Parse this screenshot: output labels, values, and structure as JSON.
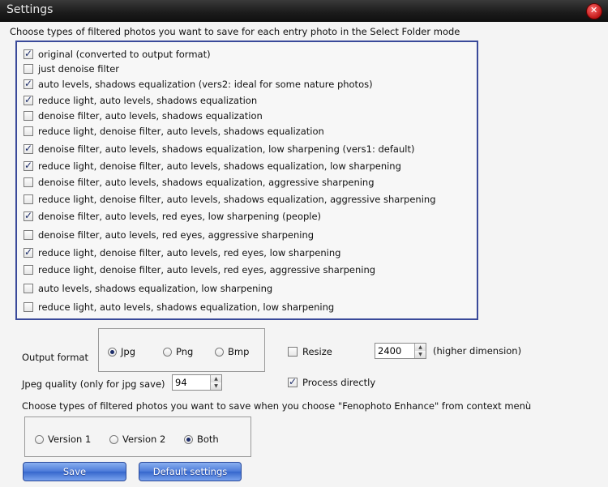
{
  "window": {
    "title": "Settings"
  },
  "heading_entry": "Choose types of filtered photos you want to save for each entry photo in the Select Folder mode",
  "filters": [
    {
      "label": "original (converted to output format)",
      "checked": true
    },
    {
      "label": "just denoise filter",
      "checked": false
    },
    {
      "label": "auto levels, shadows equalization (vers2: ideal for some nature photos)",
      "checked": true
    },
    {
      "label": "reduce light, auto levels, shadows equalization",
      "checked": true
    },
    {
      "label": "denoise filter, auto levels, shadows equalization",
      "checked": false
    },
    {
      "label": "reduce light, denoise filter, auto levels, shadows equalization",
      "checked": false
    },
    {
      "label": "denoise filter, auto levels, shadows equalization, low sharpening (vers1: default)",
      "checked": true
    },
    {
      "label": "reduce light, denoise filter, auto levels, shadows equalization, low sharpening",
      "checked": true
    },
    {
      "label": "denoise filter, auto levels, shadows equalization, aggressive sharpening",
      "checked": false
    },
    {
      "label": "reduce light, denoise filter, auto levels, shadows equalization, aggressive sharpening",
      "checked": false
    },
    {
      "label": "denoise filter, auto levels, red eyes, low sharpening (people)",
      "checked": true
    },
    {
      "label": "denoise filter, auto levels, red eyes, aggressive sharpening",
      "checked": false
    },
    {
      "label": "reduce light, denoise filter, auto levels, red eyes, low sharpening",
      "checked": true
    },
    {
      "label": "reduce light, denoise filter, auto levels, red eyes, aggressive sharpening",
      "checked": false
    },
    {
      "label": "auto levels, shadows equalization, low sharpening",
      "checked": false
    },
    {
      "label": "reduce light, auto levels, shadows equalization, low sharpening",
      "checked": false
    }
  ],
  "output_format": {
    "label": "Output format",
    "options": [
      "Jpg",
      "Png",
      "Bmp"
    ],
    "selected": "Jpg"
  },
  "resize": {
    "label": "Resize",
    "checked": false,
    "value": "2400",
    "suffix": "(higher dimension)"
  },
  "jpeg_quality": {
    "label": "Jpeg quality (only for jpg save)",
    "value": "94"
  },
  "process_directly": {
    "label": "Process directly",
    "checked": true
  },
  "heading_context": "Choose types of filtered photos you want to save when you choose \"Fenophoto Enhance\" from context menù",
  "context_versions": {
    "options": [
      "Version 1",
      "Version 2",
      "Both"
    ],
    "selected": "Both"
  },
  "buttons": {
    "save": "Save",
    "defaults": "Default settings"
  }
}
